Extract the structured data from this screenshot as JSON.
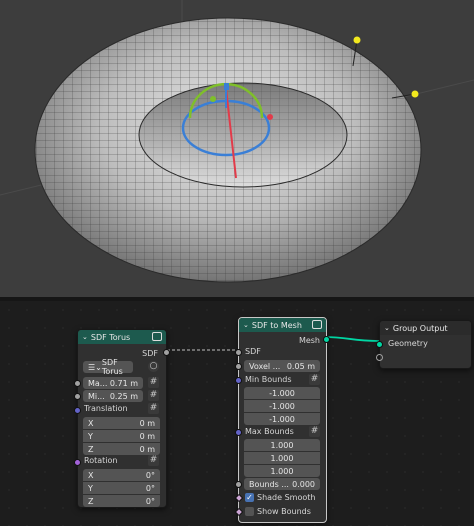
{
  "sdf_torus_node": {
    "title": "SDF Torus",
    "output_label": "SDF",
    "type_select": "SDF Torus",
    "major_radius_label": "Ma...",
    "major_radius_value": "0.71 m",
    "minor_radius_label": "Mi...",
    "minor_radius_value": "0.25 m",
    "translation_label": "Translation",
    "translation": [
      {
        "axis": "X",
        "value": "0 m"
      },
      {
        "axis": "Y",
        "value": "0 m"
      },
      {
        "axis": "Z",
        "value": "0 m"
      }
    ],
    "rotation_label": "Rotation",
    "rotation": [
      {
        "axis": "X",
        "value": "0°"
      },
      {
        "axis": "Y",
        "value": "0°"
      },
      {
        "axis": "Z",
        "value": "0°"
      }
    ]
  },
  "sdf_to_mesh_node": {
    "title": "SDF to Mesh",
    "output_label": "Mesh",
    "input_label": "SDF",
    "voxel_label": "Voxel ...",
    "voxel_value": "0.05 m",
    "min_bounds_label": "Min Bounds",
    "min_bounds": [
      "-1.000",
      "-1.000",
      "-1.000"
    ],
    "max_bounds_label": "Max Bounds",
    "max_bounds": [
      "1.000",
      "1.000",
      "1.000"
    ],
    "bounds_label": "Bounds ...",
    "bounds_value": "0.000",
    "shade_smooth_label": "Shade Smooth",
    "shade_smooth": true,
    "show_bounds_label": "Show Bounds",
    "show_bounds": false
  },
  "group_output_node": {
    "title": "Group Output",
    "input_label": "Geometry"
  },
  "colors": {
    "geometry_header": "#1d5a4e",
    "geometry_socket": "#00d6a3",
    "float_socket": "#a1a1a1",
    "vector_socket": "#6363c7",
    "rotation_socket": "#a363d9",
    "bool_socket": "#cca6d6",
    "gizmo_x": "#e23b4a",
    "gizmo_y": "#7fbf2a",
    "gizmo_z": "#3a7fd6",
    "light_yellow": "#f2e91e"
  }
}
